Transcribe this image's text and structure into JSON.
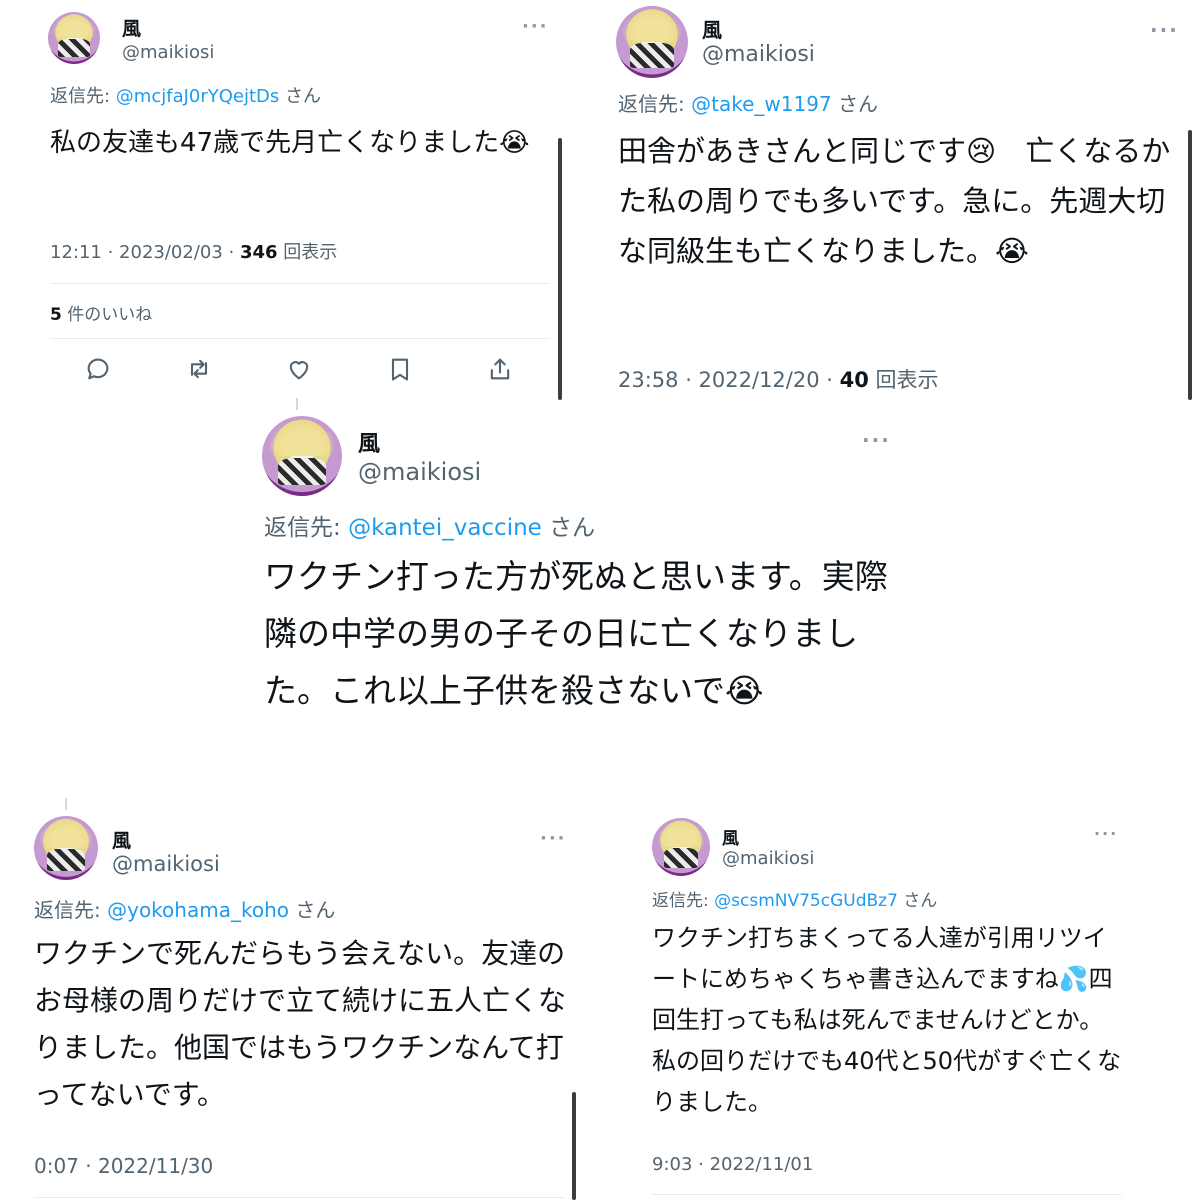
{
  "tweets": [
    {
      "name": "風",
      "handle": "@maikiosi",
      "reply_prefix": "返信先: ",
      "reply_to": "@mcjfaJ0rYQejtDs",
      "reply_suffix": " さん",
      "text": "私の友達も47歳で先月亡くなりました😭",
      "time": "12:11 · 2023/02/03 · ",
      "views": "346",
      "views_label": " 回表示",
      "likes_count": "5",
      "likes_label": " 件のいいね"
    },
    {
      "name": "風",
      "handle": "@maikiosi",
      "reply_prefix": "返信先: ",
      "reply_to": "@take_w1197",
      "reply_suffix": " さん",
      "text": "田舎があきさんと同じです😢　亡くなるかた私の周りでも多いです。急に。先週大切な同級生も亡くなりました。😭",
      "time": "23:58 · 2022/12/20 · ",
      "views": "40",
      "views_label": " 回表示"
    },
    {
      "name": "風",
      "handle": "@maikiosi",
      "reply_prefix": "返信先: ",
      "reply_to": "@kantei_vaccine",
      "reply_suffix": " さん",
      "text": "ワクチン打った方が死ぬと思います。実際隣の中学の男の子その日に亡くなりました。これ以上子供を殺さないで😭"
    },
    {
      "name": "風",
      "handle": "@maikiosi",
      "reply_prefix": "返信先: ",
      "reply_to": "@yokohama_koho",
      "reply_suffix": " さん",
      "text": "ワクチンで死んだらもう会えない。友達のお母様の周りだけで立て続けに五人亡くなりました。他国ではもうワクチンなんて打ってないです。",
      "time": "0:07 · 2022/11/30"
    },
    {
      "name": "風",
      "handle": "@maikiosi",
      "reply_prefix": "返信先: ",
      "reply_to": "@scsmNV75cGUdBz7",
      "reply_suffix": " さん",
      "text": "ワクチン打ちまくってる人達が引用リツイートにめちゃくちゃ書き込んでますね💦四回生打っても私は死んでませんけどとか。私の回りだけでも40代と50代がすぐ亡くなりました。",
      "time": "9:03 · 2022/11/01"
    }
  ],
  "more_icon": "···",
  "action_icons": [
    "reply-icon",
    "retweet-icon",
    "like-icon",
    "bookmark-icon",
    "share-icon"
  ]
}
